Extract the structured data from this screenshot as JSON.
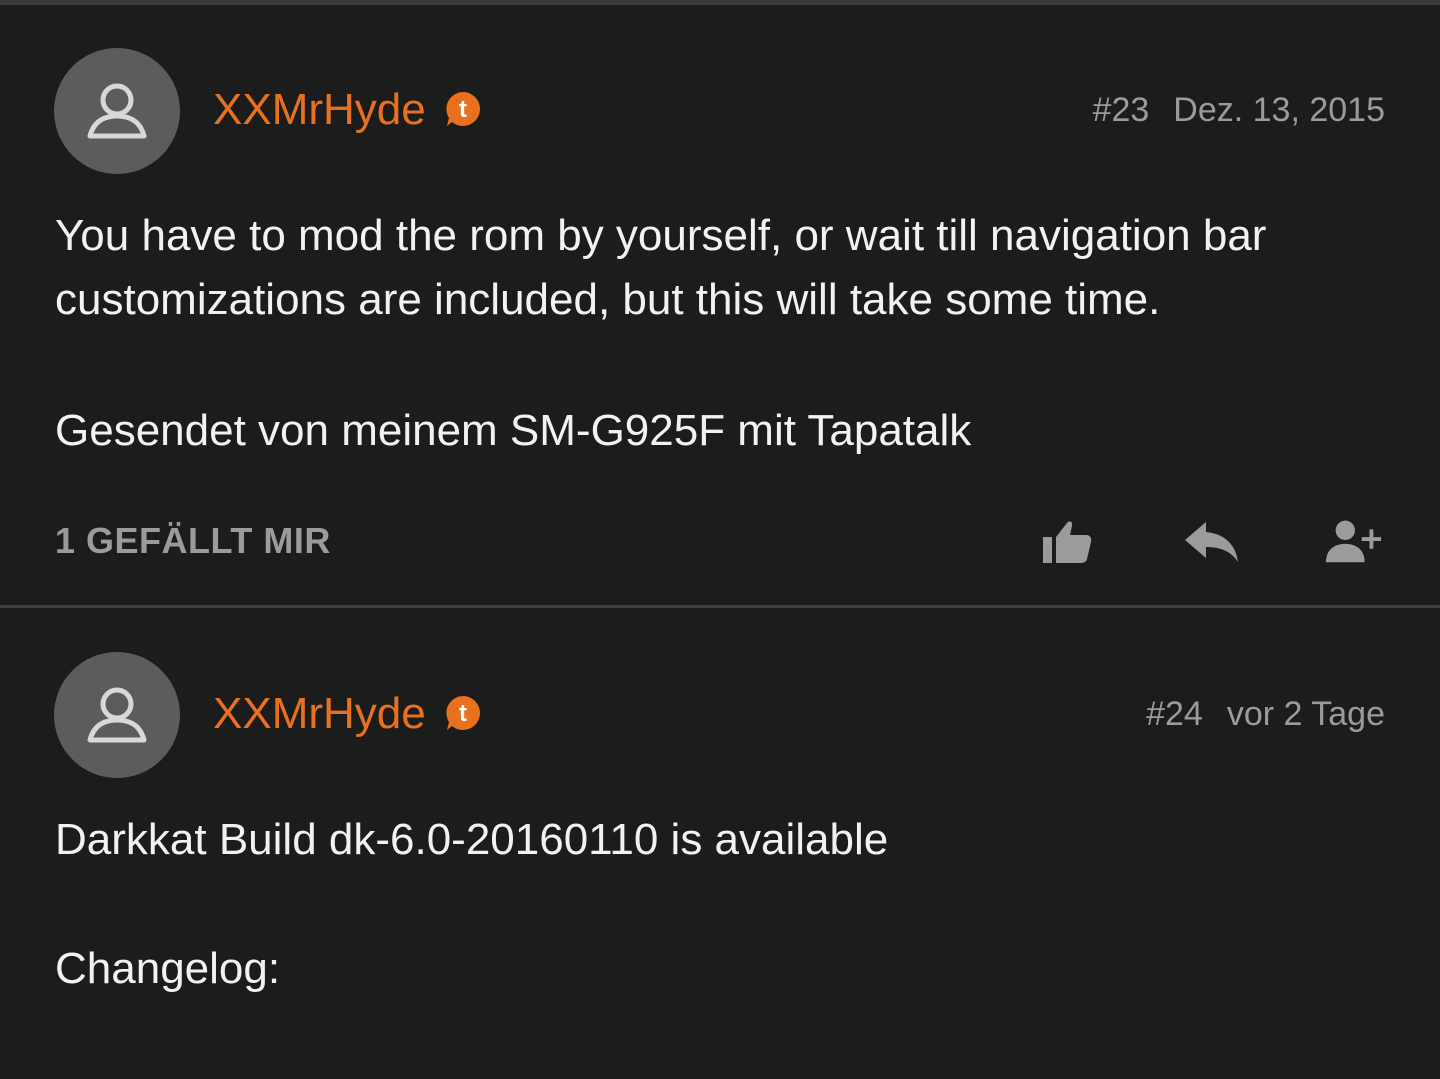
{
  "posts": [
    {
      "username": "XXMrHyde",
      "post_number": "#23",
      "date": "Dez. 13, 2015",
      "body_line1": "You have to mod the rom by yourself, or wait till navigation bar",
      "body_line2": "customizations are included, but this will take some time.",
      "signature": "Gesendet von meinem SM-G925F mit Tapatalk",
      "likes_label": "1 GEFÄLLT MIR",
      "badge_icon": "tapatalk-icon"
    },
    {
      "username": "XXMrHyde",
      "post_number": "#24",
      "date": "vor 2 Tage",
      "body_line1": "Darkkat Build dk-6.0-20160110 is available",
      "body_line2": "Changelog:",
      "badge_icon": "tapatalk-icon"
    }
  ],
  "actions": {
    "like_icon": "thumbs-up-icon",
    "reply_icon": "reply-icon",
    "follow_icon": "add-user-icon"
  },
  "colors": {
    "background": "#1b1d1c",
    "username": "#e8701f",
    "meta_text": "#9a9c9b",
    "avatar_bg": "#5b5d5c"
  }
}
